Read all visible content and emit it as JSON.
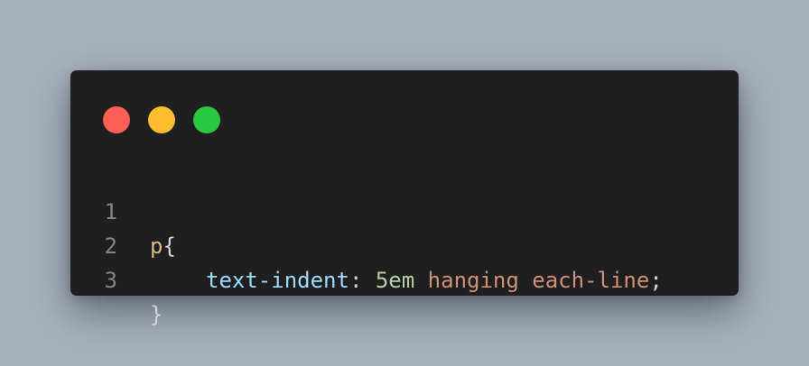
{
  "window": {
    "background": "#1f1f1f",
    "controls": [
      {
        "name": "close",
        "color": "#ff5f57"
      },
      {
        "name": "minimize",
        "color": "#febc2e"
      },
      {
        "name": "maximize",
        "color": "#28c840"
      }
    ]
  },
  "code": {
    "lines": [
      {
        "number": "1",
        "tokens": {
          "selector": "p",
          "brace_open": "{"
        }
      },
      {
        "number": "2",
        "tokens": {
          "property": "text-indent",
          "colon": ": ",
          "value_num": "5em",
          "value_kw": " hanging each-line",
          "semicolon": ";"
        }
      },
      {
        "number": "3",
        "tokens": {
          "brace_close": "}"
        }
      }
    ]
  },
  "colors": {
    "selector": "#d7ba7d",
    "property": "#9cdcfe",
    "number": "#b5cea8",
    "keyword": "#ce9178",
    "punctuation": "#d4d4d4",
    "line_number": "#858585"
  }
}
